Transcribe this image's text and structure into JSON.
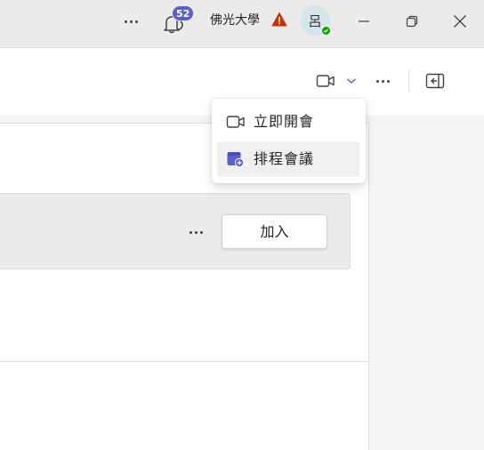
{
  "titlebar": {
    "notification_count": "52",
    "org_name": "佛光大學",
    "avatar_initial": "呂",
    "status_color": "#13a10e",
    "warning_color": "#c4320a",
    "badge_color": "#5b5fc7"
  },
  "meeting_menu": {
    "items": [
      {
        "label": "立即開會",
        "icon": "video-camera-icon"
      },
      {
        "label": "排程會議",
        "icon": "calendar-add-icon"
      }
    ]
  },
  "card": {
    "join_label": "加入"
  }
}
